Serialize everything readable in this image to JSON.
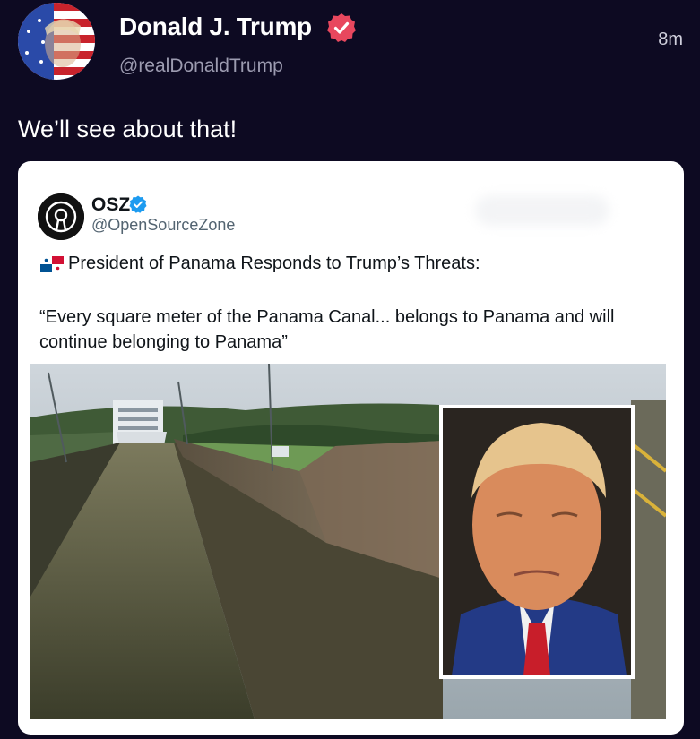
{
  "post": {
    "author_name": "Donald J. Trump",
    "author_handle": "@realDonaldTrump",
    "timestamp": "8m",
    "text": "We’ll see about that!",
    "avatar_icon": "flag-portrait-avatar",
    "verified_icon": "verified-badge-icon",
    "verified_color": "#e8475e"
  },
  "quoted": {
    "author_name": "OSZ",
    "author_handle": "@OpenSourceZone",
    "avatar_icon": "osz-logo-icon",
    "verified_icon": "verified-badge-icon",
    "verified_color": "#1d9bf0",
    "flag_icon": "panama-flag-icon",
    "headline": "President of Panama Responds to Trump’s Threats:",
    "quote": "“Every square meter of the Panama Canal... belongs to Panama and will continue belonging to Panama”",
    "media": {
      "main_image": "panama-canal-lock-photo",
      "inset_image": "trump-portrait-photo"
    }
  },
  "colors": {
    "background": "#0d0a22",
    "card": "#ffffff",
    "handle_gray": "#9c9bb0"
  }
}
